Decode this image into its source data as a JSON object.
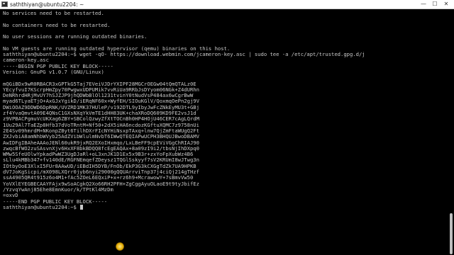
{
  "window": {
    "title": "saththiyan@ubuntu2204: ~",
    "controls": {
      "minimize": "—",
      "maximize": "☐",
      "close": "✕"
    }
  },
  "terminal": {
    "lines_before": [
      "No services need to be restarted.",
      "",
      "No containers need to be restarted.",
      "",
      "No user sessions are running outdated binaries.",
      "",
      "No VM guests are running outdated hypervisor (qemu) binaries on this host."
    ],
    "command_prompt": "saththiyan@ubuntu2204:~$",
    "command": " wget -qO- https://download.webmin.com/jcameron-key.asc | sudo tee -a /etc/apt/trusted.gpg.d/j",
    "command_wrap": "cameron-key.asc",
    "pgp_begin": "-----BEGIN PGP PUBLIC KEY BLOCK-----",
    "pgp_version": "Version: GnuPG v1.0.7 (GNU/Linux)",
    "key_lines": [
      "mQGiBDx9wR0RBACR3xGPTkG5Taj7EVeiVJDrYXIPF28MGCrOEGw04tQmQTALz0E",
      "YEcyfvuI7KScrpHmZpy70PwgwxUDPUMik7vvRiUa9RRbJsDYyom06NGk+Z4dURhn",
      "DeNRhrdHRjMvUY7hSJZJP9jhQDWbBlOl1231tvinY0tNudVsP484ax6wCgrBwW",
      "myad6TLyaETjO+AxGJxYgikD/iERqNF60x+WyfEH/SIOuKGlV/QoxmqOePn2gj9V",
      "DWiOOAZ9DDWD6DpRNK/UVZRD1MK37HUleP/v192DTL9yIbyJwFcZNkEyMU3t+GBj",
      "zf4YvaQmvtA09E4QNsC1GXsNXqYkVmTE1dHH83UK+chaXRoDQ609KD9FE2vsJ1d",
      "z9VPBACPgmuVcUKXag6ZBY+SBColQzwyZfXtTOCnBh0HP4HOjU46CER7cAgLQrdM",
      "1Uu29Al7TaEZp8Hfb37dVoTRntM+Nf50+2dX5iHA6ncdozKGftuXQMC7z9758nUi",
      "2E4Sv09hmrdM+NKonpZByt6TilhDXrFIcNYHiNsxpTAxq+lnw7QjZmFtaWUgQ2Ft",
      "ZXJvbiA8amNhbWVyb25AdZVibWlulmNvbT6IWwQTEQIAPwUCPH3BHQUJBwoDBAMV",
      "AwIDFgIBAheAAAoJENl60ukR9jxRQ2EXoIHxmqo/LxLBeFF9cpEViVGgChRIAJ90",
      "zwqcBfWO2zuSAsvnXjv6HxXF8bkBDQQ8fcEgEAQAx+8a09zI9i2/tbsNjIhDXpq0",
      "WMw5SfeUOlwYpkadPwWZ3UgDJaRl+oL3xnJK1D1Ex5x9B3r+zxYoFpXubWz4B6",
      "sLlu4kMBb347+fv140dE/RGFNEmqefZDeysz1TQGlSskyyf7sV2KRUmI8wJTwg3n",
      "IOtbyOoE3XlxI5FUr8AAwUD/iEBdIH5DYB/FnOb/EkP3G3kCXGgTdZk7UA9HPKB",
      "dV7JoKgSicpi/mX098LXQrr0jyb6nyi29000gQQUArrviTnp37j4ciQj214gTHzf",
      "ssA4905QR4t915z6o4M1+fAc5ZOeL6EQxiP+x+rz6h9+McrawowY+7sBmvVw50",
      "YoVXlEYEGBECAAYFAjx9wSoACgkQ2Xo66RH2PFH+ZgCggAyuOLaoE9t9tyJbifEz",
      "/YzvqYwAnj85Ehe8EmnKuor/k/TPtKl4MzDm"
    ],
    "key_checksum": "=oxvD",
    "pgp_end": "-----END PGP PUBLIC KEY BLOCK-----",
    "final_prompt": "saththiyan@ubuntu2204:~$"
  },
  "colors": {
    "terminal_bg": "#000000",
    "terminal_fg": "#c8c8c8",
    "titlebar_bg": "#ffffff",
    "click_indicator": "#e0a800"
  }
}
